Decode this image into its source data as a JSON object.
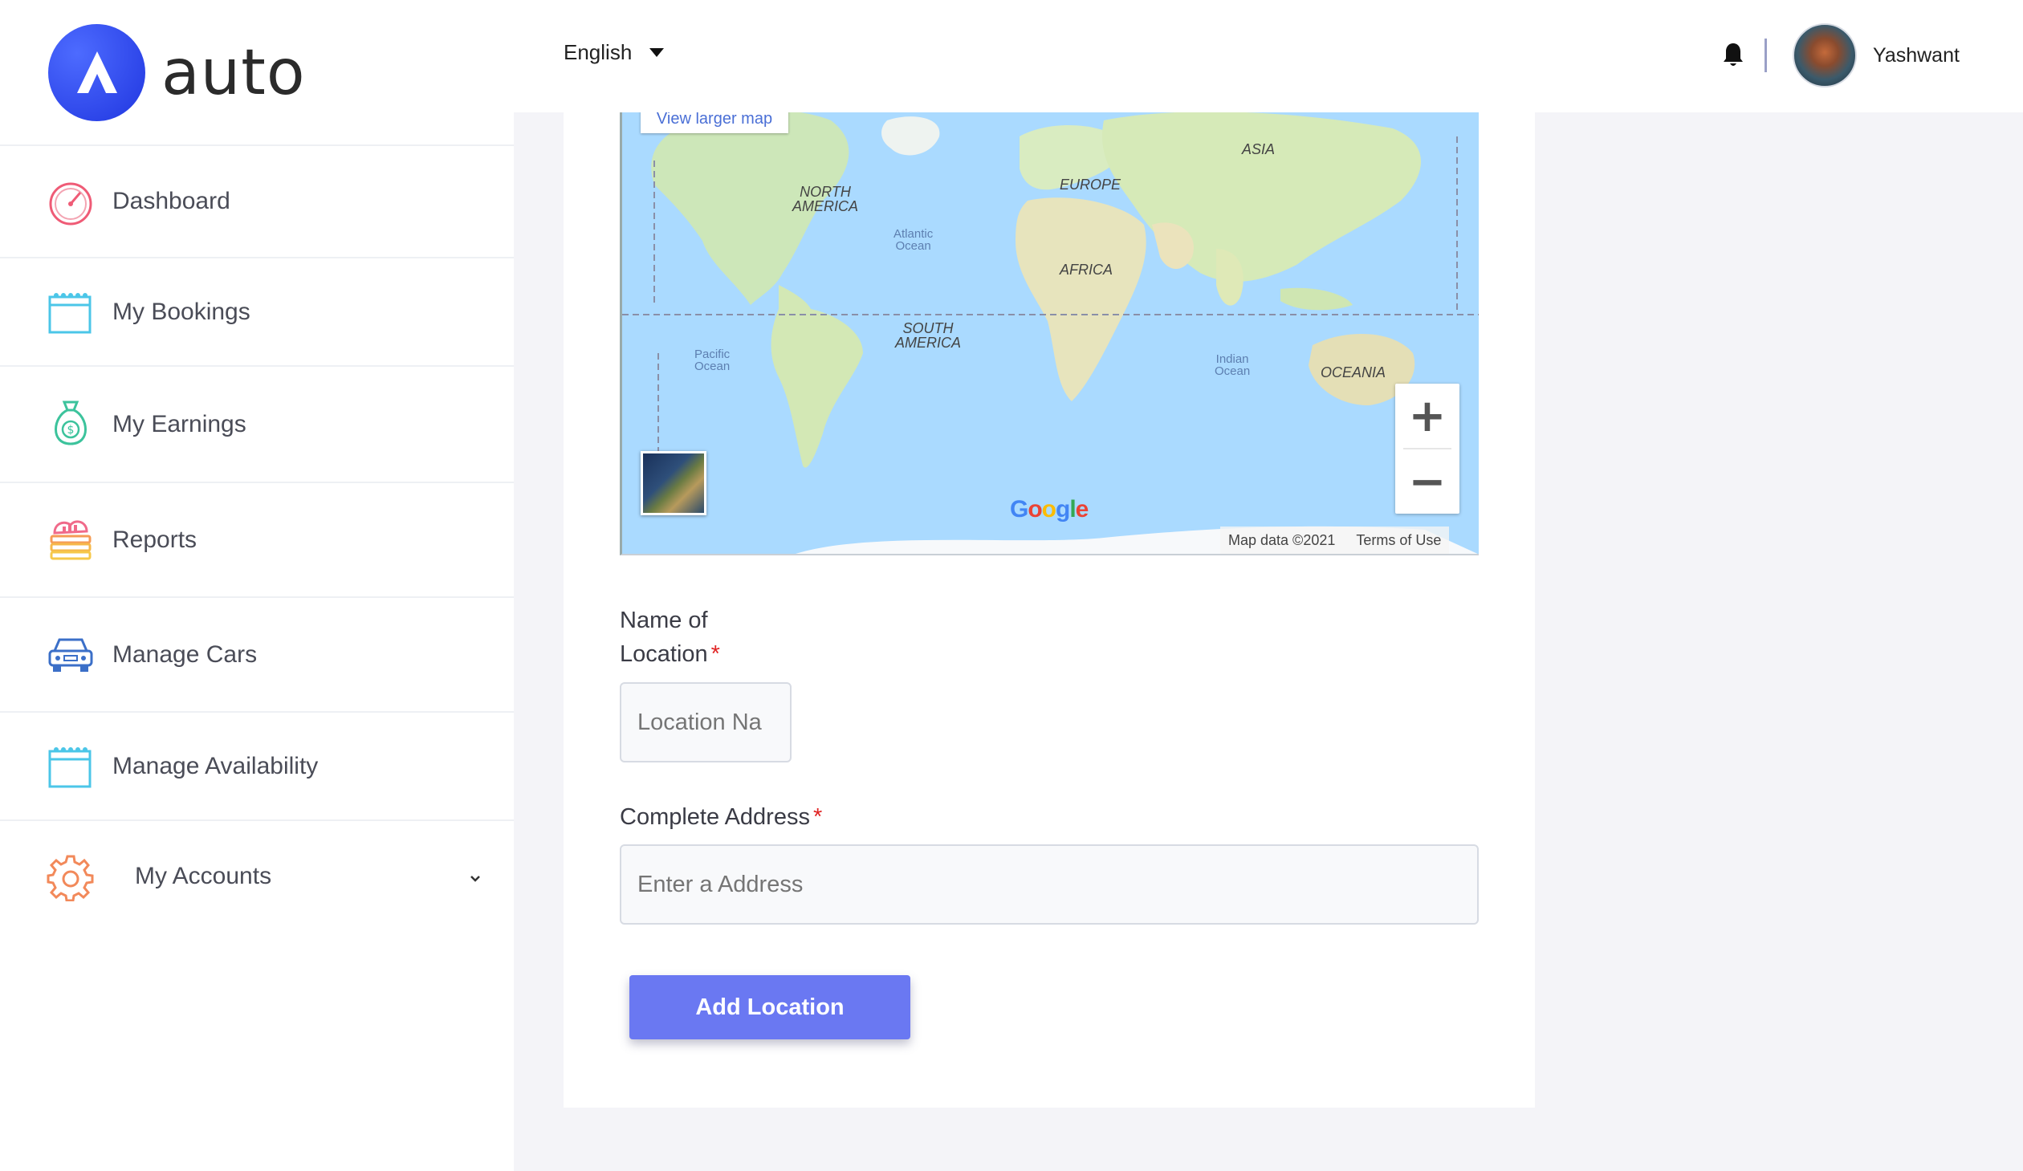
{
  "brand": {
    "name": "auto"
  },
  "header": {
    "language": "English",
    "user_name": "Yashwant"
  },
  "sidebar": {
    "items": [
      {
        "label": "Dashboard",
        "icon": "speedometer-icon"
      },
      {
        "label": "My Bookings",
        "icon": "calendar-icon"
      },
      {
        "label": "My Earnings",
        "icon": "money-bag-icon"
      },
      {
        "label": "Reports",
        "icon": "reports-icon"
      },
      {
        "label": "Manage Cars",
        "icon": "car-icon"
      },
      {
        "label": "Manage Availability",
        "icon": "calendar-icon"
      },
      {
        "label": "My Accounts",
        "icon": "gear-icon"
      }
    ]
  },
  "map": {
    "view_larger": "View larger map",
    "continents": [
      "NORTH AMERICA",
      "SOUTH AMERICA",
      "EUROPE",
      "AFRICA",
      "ASIA",
      "OCEANIA"
    ],
    "oceans": [
      "Atlantic Ocean",
      "Pacific Ocean",
      "Indian Ocean"
    ],
    "google": "Google",
    "map_data": "Map data ©2021",
    "terms": "Terms of Use",
    "zoom_in": "+",
    "zoom_out": "−"
  },
  "form": {
    "location_name_label_line1": "Name of",
    "location_name_label_line2": "Location",
    "location_name_placeholder": "Location Na",
    "address_label": "Complete Address",
    "address_placeholder": "Enter a Address",
    "required_mark": "*",
    "submit_label": "Add Location"
  },
  "colors": {
    "accent": "#6a78f2",
    "brand_blue": "#2f4bf0",
    "required": "#e02424",
    "map_water": "#aadaff"
  }
}
